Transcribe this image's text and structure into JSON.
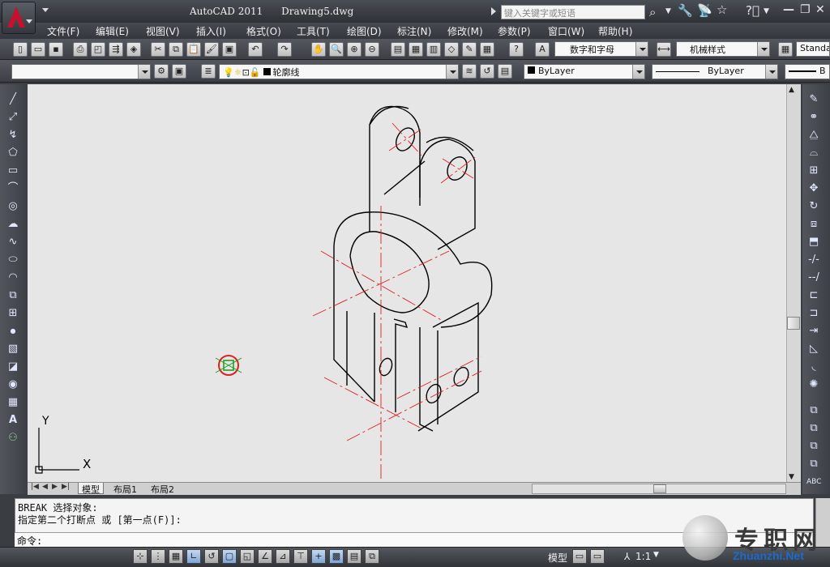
{
  "title_bar": {
    "app_title": "AutoCAD 2011",
    "doc_title": "Drawing5.dwg",
    "search_placeholder": "键入关键字或短语"
  },
  "menu": [
    "文件(F)",
    "编辑(E)",
    "视图(V)",
    "插入(I)",
    "格式(O)",
    "工具(T)",
    "绘图(D)",
    "标注(N)",
    "修改(M)",
    "参数(P)",
    "窗口(W)",
    "帮助(H)"
  ],
  "standard_toolbar": {
    "text_style": "数字和字母",
    "dim_style": "机械样式",
    "table_style": "Standa"
  },
  "layers_toolbar": {
    "workspace_value": "",
    "current_layer": "轮廓线"
  },
  "properties_toolbar": {
    "color": "ByLayer",
    "linetype": "ByLayer",
    "lineweight": "B"
  },
  "ucs": {
    "x_label": "X",
    "y_label": "Y"
  },
  "tabs": [
    "模型",
    "布局1",
    "布局2"
  ],
  "command_history": [
    "BREAK 选择对象:",
    "指定第二个打断点 或 [第一点(F)]:"
  ],
  "command_prompt": "命令:",
  "status_bar": {
    "model_label": "模型",
    "scale_label": "1:1"
  },
  "watermark": {
    "title": "专职网",
    "url": "Zhuanzhi.Net"
  },
  "colors": {
    "canvas_bg": "#e6e6e6",
    "centerline": "#e02020",
    "geometry": "#000000"
  },
  "icons": {
    "left_toolbar": [
      "line-icon",
      "construction-line-icon",
      "polyline-icon",
      "polygon-icon",
      "rectangle-icon",
      "arc-icon",
      "circle-icon",
      "revision-cloud-icon",
      "spline-icon",
      "ellipse-icon",
      "ellipse-arc-icon",
      "insert-block-icon",
      "make-block-icon",
      "point-icon",
      "hatch-icon",
      "gradient-icon",
      "region-icon",
      "table-icon",
      "text-icon",
      "add-selected-icon"
    ],
    "right_toolbar": [
      "erase-icon",
      "copy-icon",
      "mirror-icon",
      "offset-icon",
      "array-icon",
      "move-icon",
      "rotate-icon",
      "scale-icon",
      "stretch-icon",
      "trim-icon",
      "extend-icon",
      "break-at-point-icon",
      "break-icon",
      "join-icon",
      "chamfer-icon",
      "fillet-icon",
      "explode-icon"
    ],
    "right_draworder": [
      "bring-front-icon",
      "send-back-icon",
      "bring-above-icon",
      "send-under-icon",
      "text-front-icon",
      "dim-front-icon"
    ]
  }
}
